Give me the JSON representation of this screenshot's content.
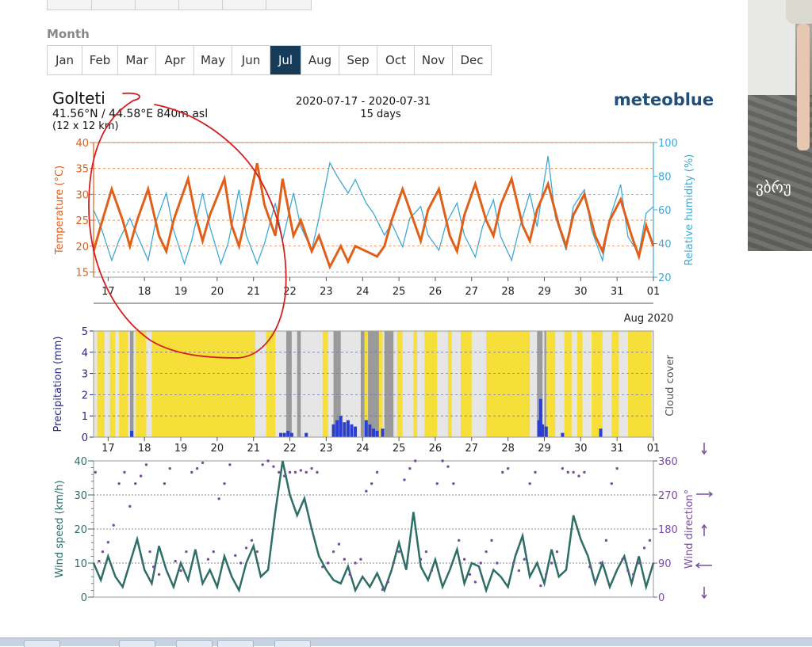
{
  "month_selector": {
    "label": "Month",
    "tabs": [
      "Jan",
      "Feb",
      "Mar",
      "Apr",
      "May",
      "Jun",
      "Jul",
      "Aug",
      "Sep",
      "Oct",
      "Nov",
      "Dec"
    ],
    "active": "Jul"
  },
  "header": {
    "location": "Golteti",
    "coords": "41.56°N / 44.58°E  840m asl",
    "grid": "(12 x 12 km)",
    "date_range": "2020-07-17 - 2020-07-31",
    "days": "15 days",
    "brand": "meteoblue"
  },
  "side_photo": {
    "caption": "ვბრუ"
  },
  "colors": {
    "temperature": "#e0601a",
    "humidity": "#3fa9d4",
    "precip": "#2a3fd0",
    "sunny": "#f7df3a",
    "wind": "#2f6e66",
    "direction": "#7a4fa0",
    "annotation": "#d22020"
  },
  "chart_data": [
    {
      "type": "line",
      "title": "",
      "x_ticks": [
        "17",
        "18",
        "19",
        "20",
        "21",
        "22",
        "23",
        "24",
        "25",
        "26",
        "27",
        "28",
        "29",
        "30",
        "31",
        "01"
      ],
      "x_note": "Aug 2020",
      "xlim": [
        16.6,
        32.0
      ],
      "ylabel": "Temperature (°C)",
      "ylim": [
        14,
        40
      ],
      "y_ticks": [
        15,
        20,
        25,
        30,
        35,
        40
      ],
      "y2label": "Relative humidity (%)",
      "y2lim": [
        20,
        100
      ],
      "y2_ticks": [
        20,
        40,
        60,
        80,
        100
      ],
      "series": [
        {
          "axis": "left",
          "color_key": "temperature",
          "x": [
            16.6,
            16.8,
            17.1,
            17.4,
            17.6,
            17.8,
            18.1,
            18.4,
            18.6,
            18.8,
            19.2,
            19.4,
            19.6,
            19.8,
            20.2,
            20.4,
            20.6,
            20.8,
            21.1,
            21.3,
            21.6,
            21.8,
            22.1,
            22.3,
            22.6,
            22.8,
            23.1,
            23.4,
            23.6,
            23.8,
            24.1,
            24.4,
            24.6,
            24.8,
            25.1,
            25.4,
            25.6,
            25.8,
            26.1,
            26.4,
            26.6,
            26.8,
            27.1,
            27.4,
            27.6,
            27.8,
            28.1,
            28.4,
            28.6,
            28.8,
            29.1,
            29.4,
            29.6,
            29.8,
            30.1,
            30.4,
            30.6,
            30.8,
            31.1,
            31.4,
            31.6,
            31.8,
            32.0
          ],
          "values": [
            19,
            24,
            31,
            25,
            20,
            25,
            31,
            22,
            19,
            25,
            33,
            26,
            21,
            26,
            33,
            24,
            20,
            26,
            36,
            28,
            22,
            33,
            22,
            25,
            19,
            22,
            16,
            20,
            17,
            20,
            19,
            18,
            20,
            25,
            31,
            25,
            21,
            27,
            31,
            22,
            19,
            26,
            32,
            25,
            22,
            28,
            33,
            24,
            21,
            27,
            32,
            24,
            20,
            26,
            30,
            22,
            19,
            25,
            29,
            22,
            18,
            24,
            20
          ]
        },
        {
          "axis": "right",
          "color_key": "humidity",
          "x": [
            16.6,
            16.8,
            17.1,
            17.3,
            17.6,
            17.8,
            18.1,
            18.3,
            18.6,
            18.8,
            19.1,
            19.3,
            19.6,
            19.8,
            20.1,
            20.3,
            20.6,
            20.8,
            21.1,
            21.3,
            21.6,
            21.8,
            22.1,
            22.3,
            22.6,
            22.8,
            23.1,
            23.3,
            23.6,
            23.8,
            24.1,
            24.3,
            24.6,
            24.8,
            25.1,
            25.3,
            25.6,
            25.8,
            26.1,
            26.3,
            26.6,
            26.8,
            27.1,
            27.3,
            27.6,
            27.8,
            28.1,
            28.3,
            28.6,
            28.8,
            29.1,
            29.3,
            29.6,
            29.8,
            30.1,
            30.3,
            30.6,
            30.8,
            31.1,
            31.3,
            31.6,
            31.8,
            32.0
          ],
          "values": [
            60,
            50,
            30,
            42,
            55,
            45,
            30,
            52,
            70,
            48,
            28,
            42,
            70,
            50,
            28,
            40,
            72,
            45,
            28,
            40,
            64,
            42,
            70,
            50,
            36,
            55,
            88,
            80,
            70,
            78,
            64,
            58,
            45,
            52,
            38,
            55,
            62,
            45,
            36,
            52,
            64,
            45,
            32,
            50,
            66,
            44,
            30,
            48,
            70,
            50,
            92,
            56,
            36,
            62,
            72,
            48,
            30,
            55,
            75,
            44,
            34,
            58,
            62
          ]
        }
      ]
    },
    {
      "type": "bar",
      "title": "",
      "x_ticks": [
        "17",
        "18",
        "19",
        "20",
        "21",
        "22",
        "23",
        "24",
        "25",
        "26",
        "27",
        "28",
        "29",
        "30",
        "31",
        "01"
      ],
      "xlim": [
        16.6,
        32.0
      ],
      "ylabel": "Precipitation (mm)",
      "ylim": [
        0,
        5
      ],
      "y_ticks": [
        0,
        1,
        2,
        3,
        4,
        5
      ],
      "y2label": "Cloud cover",
      "sunny_periods": [
        [
          16.7,
          16.9
        ],
        [
          17.05,
          17.2
        ],
        [
          17.3,
          17.55
        ],
        [
          17.75,
          18.05
        ],
        [
          18.2,
          21.05
        ],
        [
          21.35,
          21.6
        ],
        [
          22.9,
          23.05
        ],
        [
          24.05,
          24.2
        ],
        [
          24.45,
          24.55
        ],
        [
          24.95,
          25.1
        ],
        [
          25.4,
          25.5
        ],
        [
          25.7,
          26.05
        ],
        [
          26.35,
          26.45
        ],
        [
          26.7,
          27.0
        ],
        [
          27.4,
          28.6
        ],
        [
          29.05,
          29.3
        ],
        [
          29.55,
          29.75
        ],
        [
          29.9,
          30.05
        ],
        [
          30.3,
          30.6
        ],
        [
          30.85,
          31.05
        ],
        [
          31.3,
          31.95
        ]
      ],
      "dark_cloud_periods": [
        [
          17.6,
          17.7
        ],
        [
          21.9,
          22.05
        ],
        [
          22.2,
          22.3
        ],
        [
          23.2,
          23.4
        ],
        [
          23.95,
          24.05
        ],
        [
          24.15,
          24.45
        ],
        [
          24.6,
          24.85
        ],
        [
          28.8,
          28.95
        ],
        [
          29.0,
          29.05
        ]
      ],
      "precip_x": [
        17.65,
        21.75,
        21.85,
        21.95,
        22.05,
        22.45,
        23.2,
        23.3,
        23.4,
        23.5,
        23.6,
        23.7,
        23.8,
        24.1,
        24.2,
        24.3,
        24.4,
        24.55,
        28.85,
        28.9,
        28.95,
        29.05,
        29.5,
        30.55
      ],
      "precip_values": [
        0.3,
        0.2,
        0.2,
        0.3,
        0.2,
        0.2,
        0.6,
        0.8,
        1.0,
        0.7,
        0.8,
        0.6,
        0.5,
        0.8,
        0.6,
        0.4,
        0.3,
        0.4,
        0.8,
        1.8,
        0.6,
        0.5,
        0.2,
        0.4
      ]
    },
    {
      "type": "line",
      "title": "",
      "x_ticks": [
        "17",
        "18",
        "19",
        "20",
        "21",
        "22",
        "23",
        "24",
        "25",
        "26",
        "27",
        "28",
        "29",
        "30",
        "31",
        "01"
      ],
      "xlim": [
        16.6,
        32.0
      ],
      "ylabel": "Wind speed (km/h)",
      "ylim": [
        0,
        40
      ],
      "y_ticks": [
        0,
        10,
        20,
        30,
        40
      ],
      "y2label": "Wind direction°",
      "y2lim": [
        0,
        360
      ],
      "y2_ticks": [
        0,
        90,
        180,
        270,
        360
      ],
      "series": [
        {
          "axis": "left",
          "color_key": "wind",
          "x": [
            16.6,
            16.8,
            17.0,
            17.2,
            17.4,
            17.6,
            17.8,
            18.0,
            18.2,
            18.4,
            18.6,
            18.8,
            19.0,
            19.2,
            19.4,
            19.6,
            19.8,
            20.0,
            20.2,
            20.4,
            20.6,
            20.8,
            21.0,
            21.2,
            21.4,
            21.6,
            21.8,
            22.0,
            22.2,
            22.4,
            22.6,
            22.8,
            23.0,
            23.2,
            23.4,
            23.6,
            23.8,
            24.0,
            24.2,
            24.4,
            24.6,
            24.8,
            25.0,
            25.2,
            25.4,
            25.6,
            25.8,
            26.0,
            26.2,
            26.4,
            26.6,
            26.8,
            27.0,
            27.2,
            27.4,
            27.6,
            27.8,
            28.0,
            28.2,
            28.4,
            28.6,
            28.8,
            29.0,
            29.2,
            29.4,
            29.6,
            29.8,
            30.0,
            30.2,
            30.4,
            30.6,
            30.8,
            31.0,
            31.2,
            31.4,
            31.6,
            31.8,
            32.0
          ],
          "values": [
            10,
            5,
            12,
            6,
            3,
            10,
            17,
            8,
            4,
            15,
            8,
            3,
            10,
            5,
            14,
            4,
            8,
            3,
            12,
            6,
            2,
            10,
            15,
            6,
            8,
            25,
            40,
            30,
            24,
            29,
            20,
            12,
            8,
            5,
            4,
            9,
            2,
            6,
            3,
            7,
            2,
            8,
            16,
            8,
            25,
            9,
            5,
            11,
            3,
            8,
            14,
            4,
            10,
            9,
            2,
            8,
            6,
            3,
            12,
            18,
            6,
            10,
            4,
            14,
            6,
            8,
            24,
            17,
            12,
            4,
            10,
            3,
            8,
            12,
            4,
            12,
            3,
            10
          ]
        }
      ],
      "direction_x": [
        16.65,
        16.75,
        16.85,
        17.0,
        17.15,
        17.3,
        17.45,
        17.6,
        17.75,
        17.9,
        18.05,
        18.15,
        18.25,
        18.4,
        18.55,
        18.7,
        18.85,
        19.0,
        19.15,
        19.3,
        19.45,
        19.6,
        19.75,
        19.9,
        20.05,
        20.2,
        20.35,
        20.5,
        20.65,
        20.8,
        20.95,
        21.1,
        21.25,
        21.4,
        21.55,
        21.7,
        21.85,
        22.0,
        22.15,
        22.3,
        22.45,
        22.6,
        22.75,
        22.9,
        23.05,
        23.2,
        23.35,
        23.5,
        23.65,
        23.8,
        23.95,
        24.1,
        24.25,
        24.4,
        24.55,
        24.7,
        24.85,
        25.0,
        25.15,
        25.3,
        25.45,
        25.6,
        25.75,
        25.9,
        26.05,
        26.2,
        26.35,
        26.5,
        26.65,
        26.8,
        26.95,
        27.1,
        27.25,
        27.4,
        27.55,
        27.7,
        27.85,
        28.0,
        28.15,
        28.3,
        28.45,
        28.6,
        28.75,
        28.9,
        29.05,
        29.2,
        29.35,
        29.5,
        29.65,
        29.8,
        29.95,
        30.1,
        30.25,
        30.4,
        30.55,
        30.7,
        30.85,
        31.0,
        31.15,
        31.3,
        31.45,
        31.6,
        31.75,
        31.9
      ],
      "direction_values": [
        330,
        95,
        120,
        145,
        190,
        300,
        330,
        240,
        300,
        320,
        350,
        120,
        80,
        60,
        300,
        340,
        95,
        70,
        120,
        330,
        340,
        355,
        100,
        120,
        260,
        300,
        350,
        110,
        90,
        130,
        150,
        120,
        350,
        360,
        345,
        330,
        320,
        330,
        330,
        335,
        330,
        340,
        330,
        80,
        90,
        120,
        140,
        100,
        60,
        90,
        100,
        280,
        300,
        330,
        20,
        40,
        90,
        120,
        310,
        340,
        360,
        100,
        120,
        70,
        300,
        360,
        345,
        300,
        150,
        100,
        60,
        40,
        90,
        120,
        150,
        90,
        330,
        340,
        90,
        70,
        100,
        300,
        330,
        30,
        60,
        90,
        120,
        340,
        330,
        330,
        320,
        330,
        80,
        40,
        90,
        150,
        300,
        340,
        100,
        70,
        60,
        90,
        130,
        150
      ]
    }
  ]
}
